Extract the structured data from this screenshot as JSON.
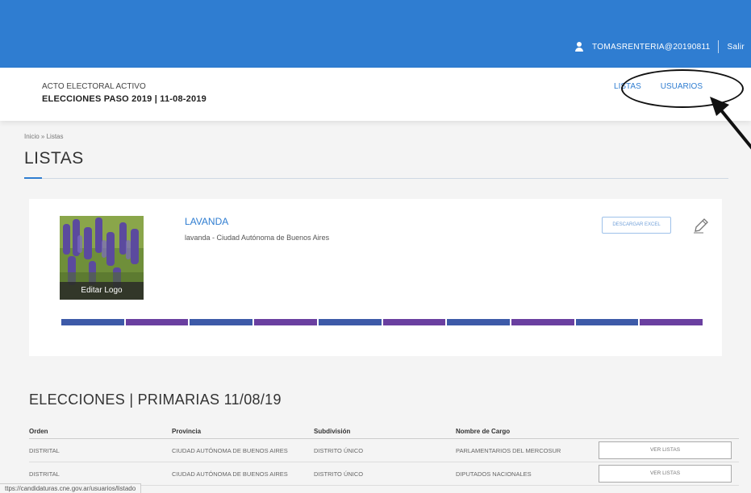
{
  "topbar": {
    "username": "TOMASRENTERIA@20190811",
    "logout": "Salir",
    "bg_color": "#2f7dd1"
  },
  "header": {
    "acto_label": "ACTO ELECTORAL ACTIVO",
    "acto_title": "ELECCIONES PASO 2019 | 11-08-2019",
    "nav": [
      {
        "label": "LISTAS"
      },
      {
        "label": "USUARIOS"
      }
    ]
  },
  "breadcrumb": {
    "home": "Inicio",
    "separator": "»",
    "current": "Listas"
  },
  "page_title": "LISTAS",
  "card": {
    "logo_icon": "lavender-photo",
    "edit_logo_label": "Editar Logo",
    "list_name": "LAVANDA",
    "list_subtitle": "lavanda - Ciudad Autónoma de Buenos Aires",
    "excel_button": "DESCARGAR EXCEL",
    "edit_icon": "pencil-icon",
    "stripe_colors": [
      "#3d5aa8",
      "#6a3fa0",
      "#3d5aa8",
      "#6a3fa0",
      "#3d5aa8",
      "#6a3fa0",
      "#3d5aa8",
      "#6a3fa0",
      "#3d5aa8",
      "#6a3fa0"
    ]
  },
  "elecciones_title": "ELECCIONES | PRIMARIAS 11/08/19",
  "table": {
    "headers": [
      "Orden",
      "Provincia",
      "Subdivisión",
      "Nombre de Cargo"
    ],
    "rows": [
      {
        "orden": "DISTRITAL",
        "provincia": "CIUDAD AUTÓNOMA DE BUENOS AIRES",
        "subdivision": "DISTRITO ÚNICO",
        "cargo": "PARLAMENTARIOS DEL MERCOSUR",
        "action": "VER LISTAS"
      },
      {
        "orden": "DISTRITAL",
        "provincia": "CIUDAD AUTÓNOMA DE BUENOS AIRES",
        "subdivision": "DISTRITO ÚNICO",
        "cargo": "DIPUTADOS NACIONALES",
        "action": "VER LISTAS"
      }
    ]
  },
  "status_url": "ttps://candidaturas.cne.gov.ar/usuarios/listado"
}
